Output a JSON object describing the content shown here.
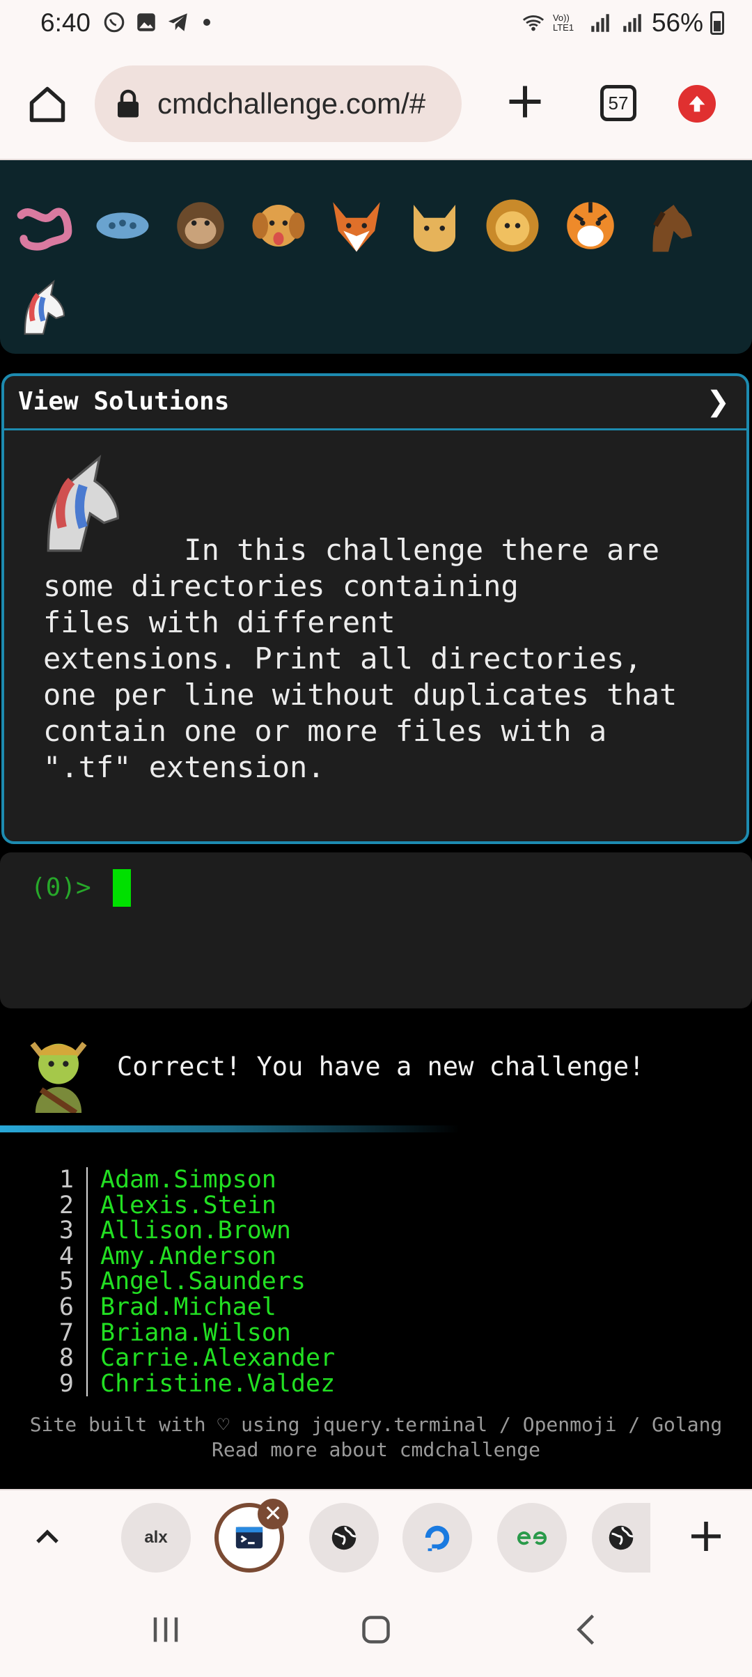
{
  "status_bar": {
    "time": "6:40",
    "network_label": "Vo)) LTE1",
    "battery_percent": "56%"
  },
  "browser": {
    "url": "cmdchallenge.com/#",
    "tab_count": "57"
  },
  "solutions": {
    "header": "View Solutions",
    "chevron": "❯",
    "challenge_text": "In this challenge there are\nsome directories containing\nfiles with different\nextensions. Print all directories,\none per line without duplicates that\ncontain one or more files with a\n\".tf\" extension."
  },
  "terminal": {
    "prompt": "(0)>"
  },
  "feedback": {
    "message": "Correct! You have a new challenge!"
  },
  "results": [
    {
      "n": "1",
      "name": "Adam.Simpson"
    },
    {
      "n": "2",
      "name": "Alexis.Stein"
    },
    {
      "n": "3",
      "name": "Allison.Brown"
    },
    {
      "n": "4",
      "name": "Amy.Anderson"
    },
    {
      "n": "5",
      "name": "Angel.Saunders"
    },
    {
      "n": "6",
      "name": "Brad.Michael"
    },
    {
      "n": "7",
      "name": "Briana.Wilson"
    },
    {
      "n": "8",
      "name": "Carrie.Alexander"
    },
    {
      "n": "9",
      "name": "Christine.Valdez"
    }
  ],
  "footer": {
    "line1": "Site built with ♡ using jquery.terminal / Openmoji / Golang",
    "line2": "Read more about cmdchallenge"
  },
  "toolbar": {
    "tab1_label": "alx",
    "close_label": "✕"
  },
  "emojis": [
    "worm-icon",
    "microbe-icon",
    "monkey-icon",
    "dog-icon",
    "fox-icon",
    "cat-icon",
    "lion-icon",
    "tiger-icon",
    "horse-icon",
    "unicorn-icon"
  ]
}
